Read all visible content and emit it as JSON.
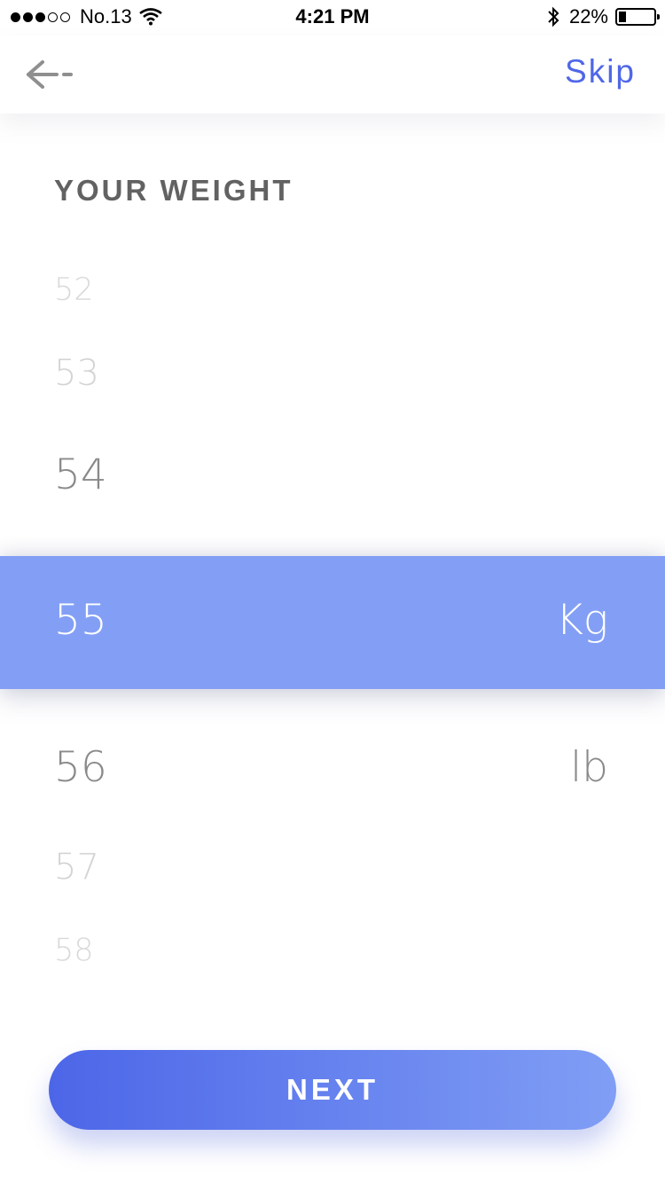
{
  "status_bar": {
    "signal_dots": [
      true,
      true,
      true,
      false,
      false
    ],
    "carrier": "No.13",
    "time": "4:21 PM",
    "battery_percent_text": "22%",
    "battery_level": 0.22,
    "icons": [
      "wifi-icon",
      "bluetooth-icon",
      "battery-icon"
    ]
  },
  "nav": {
    "back_icon": "arrow-left-icon",
    "skip_label": "Skip",
    "accent_color": "#4f67e7"
  },
  "page": {
    "title": "YOUR WEIGHT"
  },
  "picker": {
    "values_above": [
      "52",
      "53",
      "54"
    ],
    "selected_value": "55",
    "values_below": [
      "56",
      "57",
      "58"
    ],
    "units": {
      "selected": "Kg",
      "other": "lb"
    },
    "selected_row_color": "#839ff5"
  },
  "footer": {
    "next_label": "NEXT",
    "gradient_start": "#4c66e8",
    "gradient_end": "#809ef5"
  }
}
